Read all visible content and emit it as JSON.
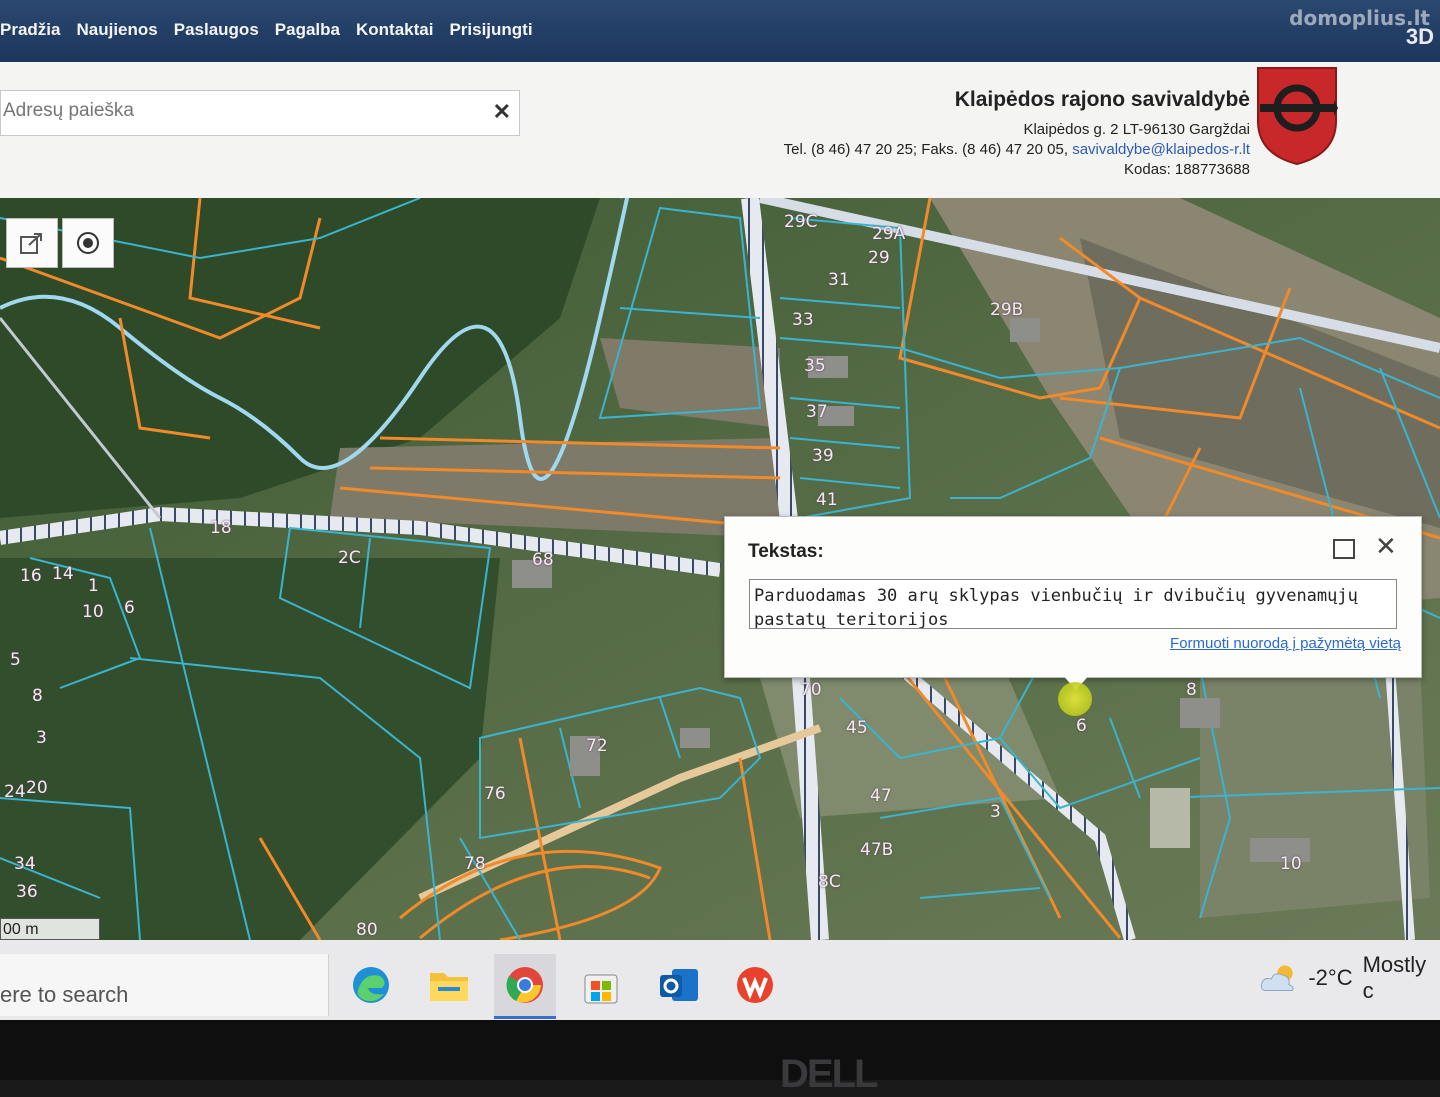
{
  "nav": {
    "items": [
      "Pradžia",
      "Naujienos",
      "Paslaugos",
      "Pagalba",
      "Kontaktai",
      "Prisijungti"
    ],
    "watermark": "domoplius.lt",
    "view_3d": "3D"
  },
  "search": {
    "placeholder": "Adresų paieška",
    "clear_icon": "close-icon"
  },
  "municipality": {
    "name": "Klaipėdos rajono savivaldybė",
    "address": "Klaipėdos g. 2 LT-96130 Gargždai",
    "contacts_prefix": "Tel. (8 46) 47 20 25; Faks. (8 46) 47 20 05,",
    "email": "savivaldybe@klaipedos-r.lt",
    "code": "Kodas: 188773688",
    "crest_colors": {
      "shield": "#c8282a",
      "emblem": "#1e1e1e"
    }
  },
  "map_tools": [
    "share-icon",
    "locate-icon"
  ],
  "map": {
    "scale_label": "00 m",
    "colors": {
      "cadastral": "#3bb4cf",
      "planning": "#f08a2a",
      "road": "#dfe6ee"
    },
    "plot_labels": [
      "29C",
      "29A",
      "29",
      "31",
      "33",
      "29B",
      "35",
      "37",
      "39",
      "41",
      "18",
      "2C",
      "68",
      "16",
      "14",
      "1",
      "10",
      "8",
      "6",
      "5",
      "3",
      "70",
      "45",
      "72",
      "8",
      "6",
      "47",
      "3",
      "76",
      "78",
      "47B",
      "8C",
      "10",
      "80",
      "20",
      "24",
      "34",
      "36"
    ]
  },
  "popup": {
    "title": "Tekstas:",
    "text": "Parduodamas 30 arų sklypas vienbučių ir dvibučių gyvenamųjų pastatų teritorijos",
    "link": "Formuoti nuorodą į pažymėtą vietą"
  },
  "taskbar": {
    "search_placeholder": "ere to search",
    "apps": [
      "edge-icon",
      "file-explorer-icon",
      "chrome-icon",
      "store-icon",
      "outlook-icon",
      "wps-icon"
    ],
    "weather": {
      "temp": "-2°C",
      "desc": "Mostly c"
    }
  },
  "device_brand": "DELL"
}
